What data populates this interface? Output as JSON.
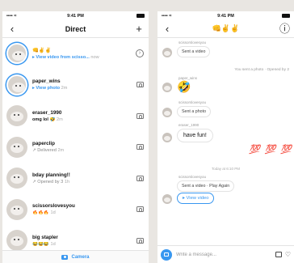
{
  "colors": {
    "accent": "#3897f0",
    "hundred_red": "#dd2222"
  },
  "left": {
    "status": {
      "time": "9:41 PM",
      "carrier": "•••• ≈"
    },
    "nav": {
      "back": "‹",
      "title": "Direct",
      "add": "+"
    },
    "threads": [
      {
        "name": "👊✌️✌️",
        "sub": "▸ View video from scisso...",
        "time": "now",
        "sub_style": "blue",
        "action_icon": "chevron-circle-icon"
      },
      {
        "name": "paper_wins",
        "sub": "▸ View photo",
        "time": "2m",
        "sub_style": "blue",
        "action_icon": "camera-icon"
      },
      {
        "name": "eraser_1990",
        "sub": "omg lol 🤣",
        "time": "2m",
        "sub_style": "dark",
        "action_icon": "camera-icon"
      },
      {
        "name": "paperclip",
        "sub": "↗ Delivered",
        "time": "2m",
        "sub_style": "gray",
        "action_icon": "camera-icon"
      },
      {
        "name": "bday planning!!",
        "sub": "↗ Opened by 3",
        "time": "1h",
        "sub_style": "gray",
        "action_icon": "camera-icon"
      },
      {
        "name": "scissorslovesyou",
        "sub": "🔥🔥🔥",
        "time": "1d",
        "sub_style": "gray",
        "action_icon": "camera-icon"
      },
      {
        "name": "big stapler",
        "sub": "😂😂😂",
        "time": "1d",
        "sub_style": "gray",
        "action_icon": "camera-icon"
      }
    ],
    "camera_label": "Camera"
  },
  "right": {
    "status": {
      "time": "9:41 PM",
      "carrier": "•••• ≈"
    },
    "nav": {
      "back": "‹",
      "title": "👊✌️✌️",
      "info": "ⓘ"
    },
    "messages": {
      "m1_sender": "scissorslovesyou",
      "m1_text": "Sent a video",
      "m2_note": "You sent a photo · Opened by 2",
      "m3_sender": "paper_wins",
      "m3_emoji": "🤣",
      "m4_sender": "scissorslovesyou",
      "m4_text": "Sent a photo",
      "m5_sender": "eraser_1990",
      "m5_text": "have fun!",
      "m6_emoji": "💯 💯 💯",
      "m7_time": "Today at 6:10 PM",
      "m8_sender": "scissorslovesyou",
      "m8_text": "Sent a video · Play Again",
      "m9_button": "▸ View video"
    },
    "composer": {
      "placeholder": "Write a message...",
      "heart": "♡"
    }
  }
}
